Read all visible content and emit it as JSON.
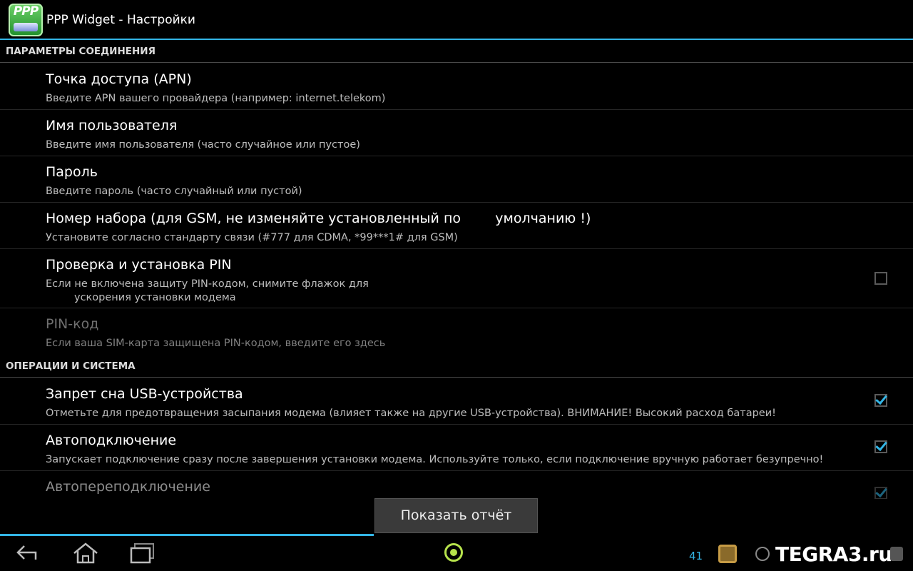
{
  "action_bar": {
    "app_icon_text": "PPP",
    "title": "PPP Widget - Настройки"
  },
  "sections": [
    {
      "header": "ПАРАМЕТРЫ СОЕДИНЕНИЯ",
      "items": [
        {
          "title": "Точка доступа (APN)",
          "summary": "Введите APN вашего провайдера (например: internet.telekom)"
        },
        {
          "title": "Имя пользователя",
          "summary": "Введите имя пользователя (часто случайное или пустое)"
        },
        {
          "title": "Пароль",
          "summary": "Введите пароль (часто случайный или пустой)"
        },
        {
          "title": "Номер набора (для GSM, не изменяйте установленный по        умолчанию !)",
          "summary": "Установите согласно стандарту связи (#777 для CDMA, *99***1# для GSM)"
        },
        {
          "title": "Проверка и установка PIN",
          "summary_line1": "Если не включена защиту PIN-кодом, снимите флажок для",
          "summary_line2": "ускорения установки модема",
          "checked": false
        },
        {
          "title": "PIN-код",
          "summary": "Если ваша SIM-карта защищена PIN-кодом, введите его здесь",
          "enabled": false
        }
      ]
    },
    {
      "header": "ОПЕРАЦИИ И СИСТЕМА",
      "items": [
        {
          "title": "Запрет сна USB-устройства",
          "summary": "Отметьте для предотвращения засыпания модема (влияет также на другие USB-устройства). ВНИМАНИЕ! Высокий расход батареи!",
          "checked": true
        },
        {
          "title": "Автоподключение",
          "summary": "Запускает подключение сразу после завершения установки модема. Используйте только, если подключение вручную работает безупречно!",
          "checked": true
        },
        {
          "title": "Автопереподключение",
          "checked": true
        }
      ]
    }
  ],
  "toast": {
    "text": "Показать отчёт"
  },
  "status_bar": {
    "time_fragment": "41",
    "watermark": "TEGRA3.ru"
  },
  "colors": {
    "accent": "#33b5e5",
    "background": "#000000",
    "check": "#33b5e5"
  }
}
